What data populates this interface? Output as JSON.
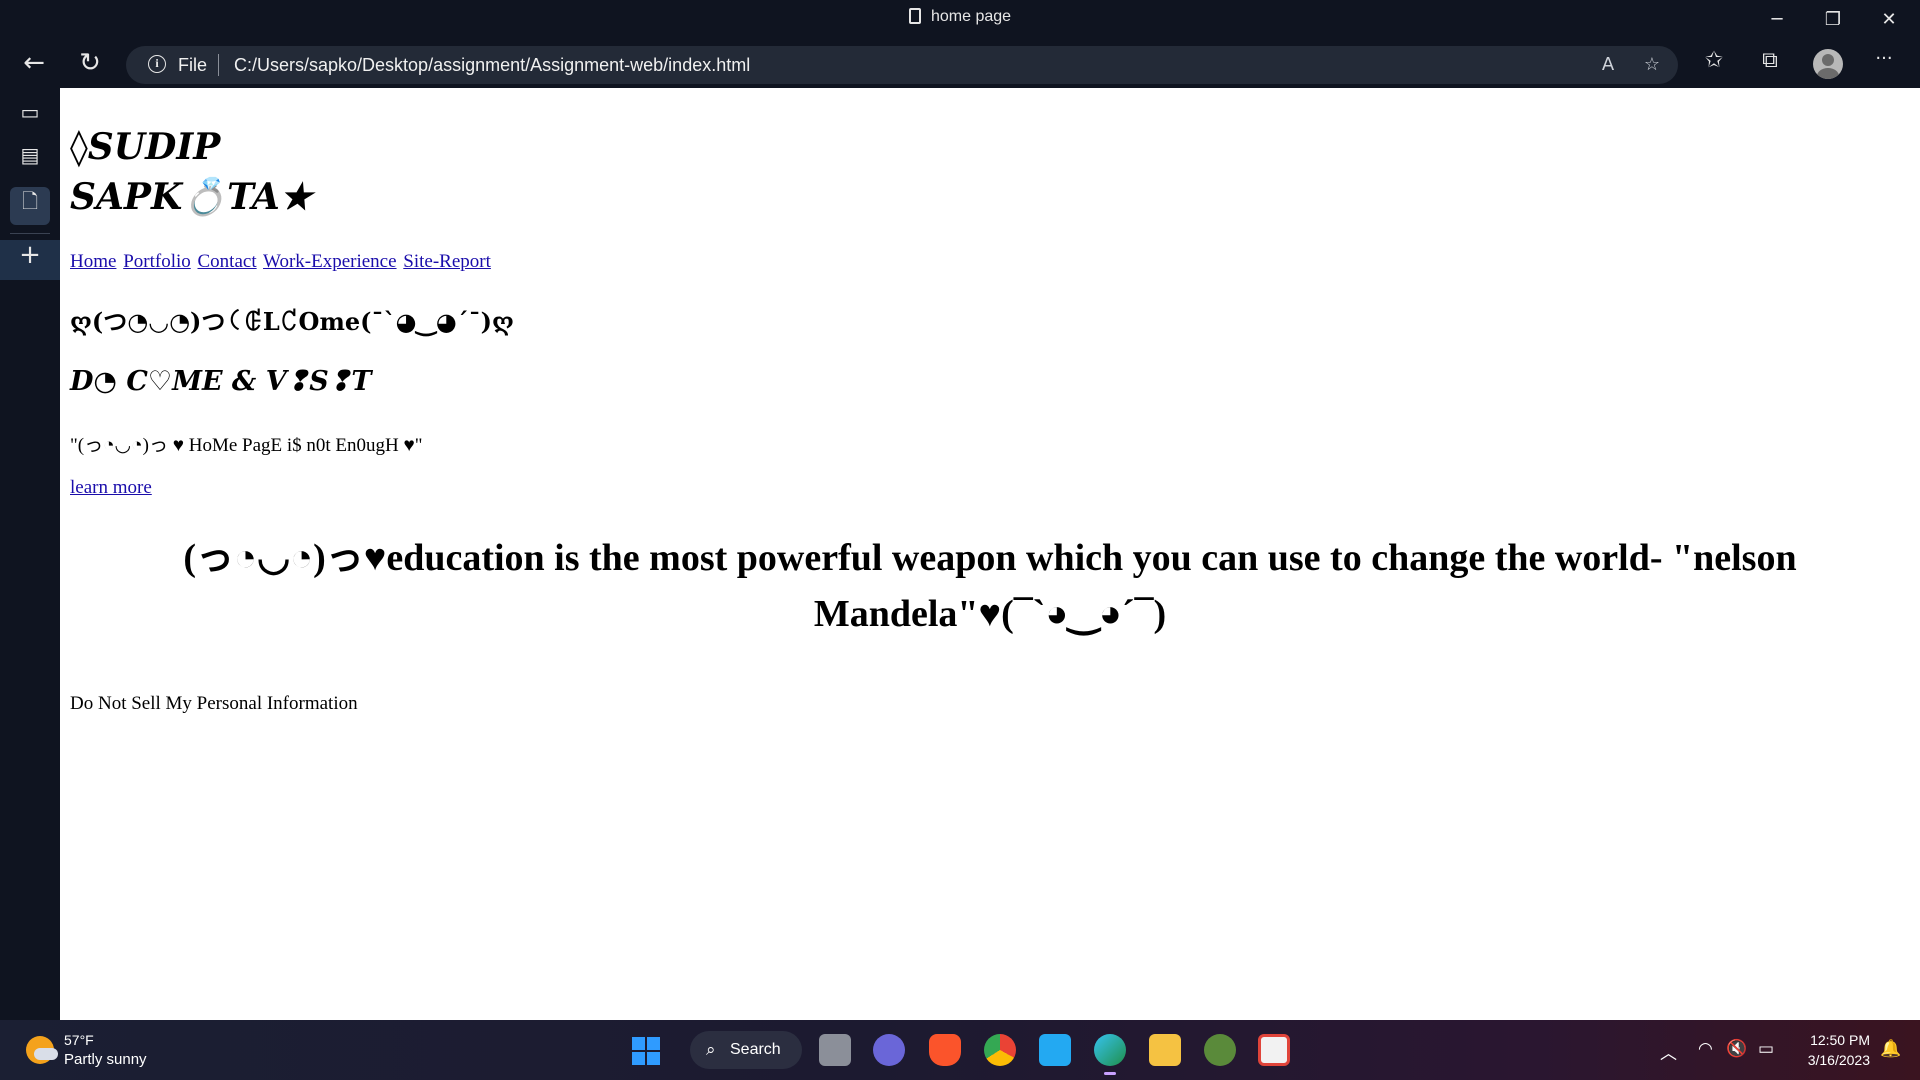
{
  "window": {
    "title": "home page",
    "minimize_glyph": "─",
    "restore_glyph": "❐",
    "close_glyph": "✕"
  },
  "toolbar": {
    "back_glyph": "←",
    "refresh_glyph": "↻",
    "address": {
      "info_glyph": "i",
      "scheme_label": "File",
      "url": "C:/Users/sapko/Desktop/assignment/Assignment-web/index.html"
    },
    "read_aloud_glyph": "A",
    "add_favorite_glyph": "☆",
    "favorites_glyph": "✩",
    "collections_glyph": "⧉",
    "more_glyph": "···"
  },
  "sidebar": {
    "tab_actions_glyph": "▭",
    "history_glyph": "▤",
    "active_tab_glyph": "🗋",
    "new_tab_glyph": "+"
  },
  "page": {
    "brand_line1": "◊SUDIP",
    "brand_line2": "SAPK💍TA★",
    "nav": [
      "Home",
      "Portfolio",
      "Contact",
      "Work-Experience",
      "Site-Report"
    ],
    "welcome": "ღ(つ◔◡◔)つ꒟ꂅL꒝Ome(¯`◕‿◕´¯)ღ",
    "visit": "D◔ C♡ME & V❢S❢T",
    "tagline": "\"(っ◔◡◔)っ ♥ HoMe PagE i$ n0t En0ugH ♥\"",
    "learn_more": "learn more",
    "quote": "(っ◔◡◔)っ♥education is the most powerful weapon which you can use to change the world- \"nelson Mandela\"♥(¯`◕‿◕´¯)",
    "footer_text": "Do Not Sell My Personal Information"
  },
  "taskbar": {
    "weather_temp": "57°F",
    "weather_condition": "Partly sunny",
    "search_glyph": "⌕",
    "search_label": "Search",
    "apps": [
      "task-view",
      "teams",
      "brave",
      "chrome",
      "vscode",
      "edge",
      "file-explorer",
      "app",
      "store"
    ],
    "tray_chevron_glyph": "︿",
    "wifi_glyph": "◠",
    "volume_glyph": "🔇",
    "battery_glyph": "▭",
    "time": "12:50 PM",
    "date": "3/16/2023",
    "notification_glyph": "🔔"
  },
  "colors": {
    "chrome_bg": "#0f1420",
    "address_bg": "#232a37",
    "link": "#1a0dab",
    "page_bg": "#ffffff"
  }
}
